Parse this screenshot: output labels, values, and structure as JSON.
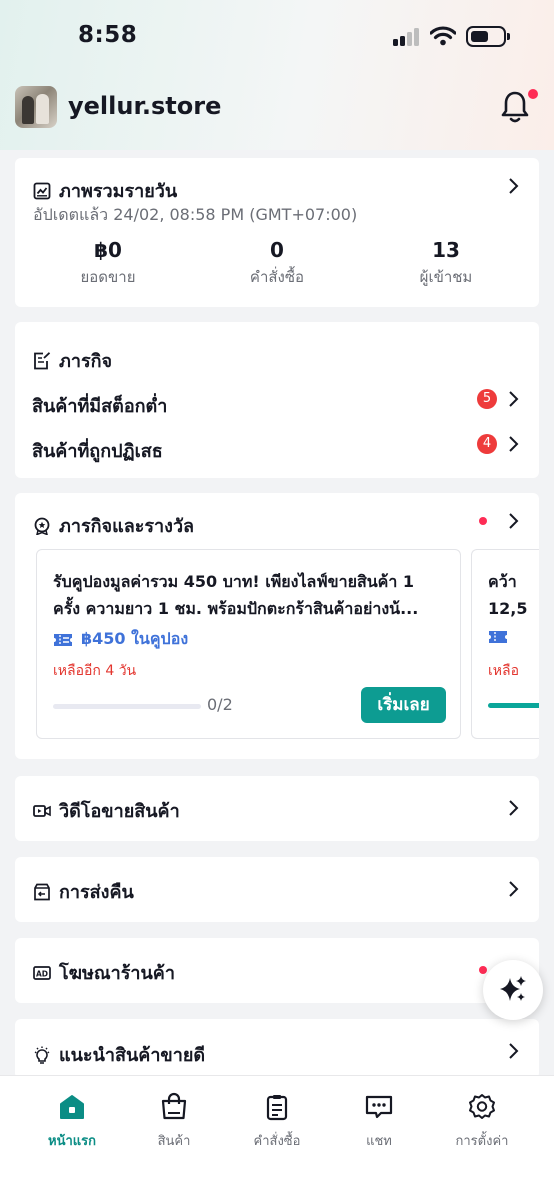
{
  "status_bar": {
    "time": "8:58"
  },
  "header": {
    "store_name": "yellur.store"
  },
  "overview": {
    "title": "ภาพรวมรายวัน",
    "updated": "อัปเดตแล้ว 24/02, 08:58 PM (GMT+07:00)",
    "stats": [
      {
        "value": "฿0",
        "label": "ยอดขาย"
      },
      {
        "value": "0",
        "label": "คำสั่งซื้อ"
      },
      {
        "value": "13",
        "label": "ผู้เข้าชม"
      }
    ]
  },
  "tasks": {
    "title": "ภารกิจ",
    "items": [
      {
        "label": "สินค้าที่มีสต็อกต่ำ",
        "count": "5"
      },
      {
        "label": "สินค้าที่ถูกปฏิเสธ",
        "count": "4"
      }
    ]
  },
  "missions": {
    "title": "ภารกิจและรางวัล",
    "cards": [
      {
        "description": "รับคูปองมูลค่ารวม 450 บาท! เพียงไลฟ์ขายสินค้า 1\nครั้ง ความยาว 1 ชม. พร้อมปักตะกร้าสินค้าอย่างน้...",
        "coupon": "฿450 ในคูปอง",
        "remaining": "เหลืออีก 4 วัน",
        "progress_text": "0/2",
        "progress_fraction": 0,
        "button": "เริ่มเลย"
      },
      {
        "description": "คว้า\n12,5",
        "remaining": "เหลือ"
      }
    ]
  },
  "menu": {
    "video": "วิดีโอขายสินค้า",
    "returns": "การส่งคืน",
    "ads": "โฆษณาร้านค้า",
    "recommend": "แนะนำสินค้าขายดี"
  },
  "tabbar": {
    "items": [
      {
        "label": "หน้าแรก",
        "icon": "home-icon",
        "active": true
      },
      {
        "label": "สินค้า",
        "icon": "bag-icon"
      },
      {
        "label": "คำสั่งซื้อ",
        "icon": "clipboard-icon"
      },
      {
        "label": "แชท",
        "icon": "chat-icon"
      },
      {
        "label": "การตั้งค่า",
        "icon": "gear-icon"
      }
    ]
  },
  "colors": {
    "accent": "#0d9c92",
    "badge_red": "#ee3b3b",
    "coupon_blue": "#3f72d9",
    "warning_red": "#e3362f"
  }
}
